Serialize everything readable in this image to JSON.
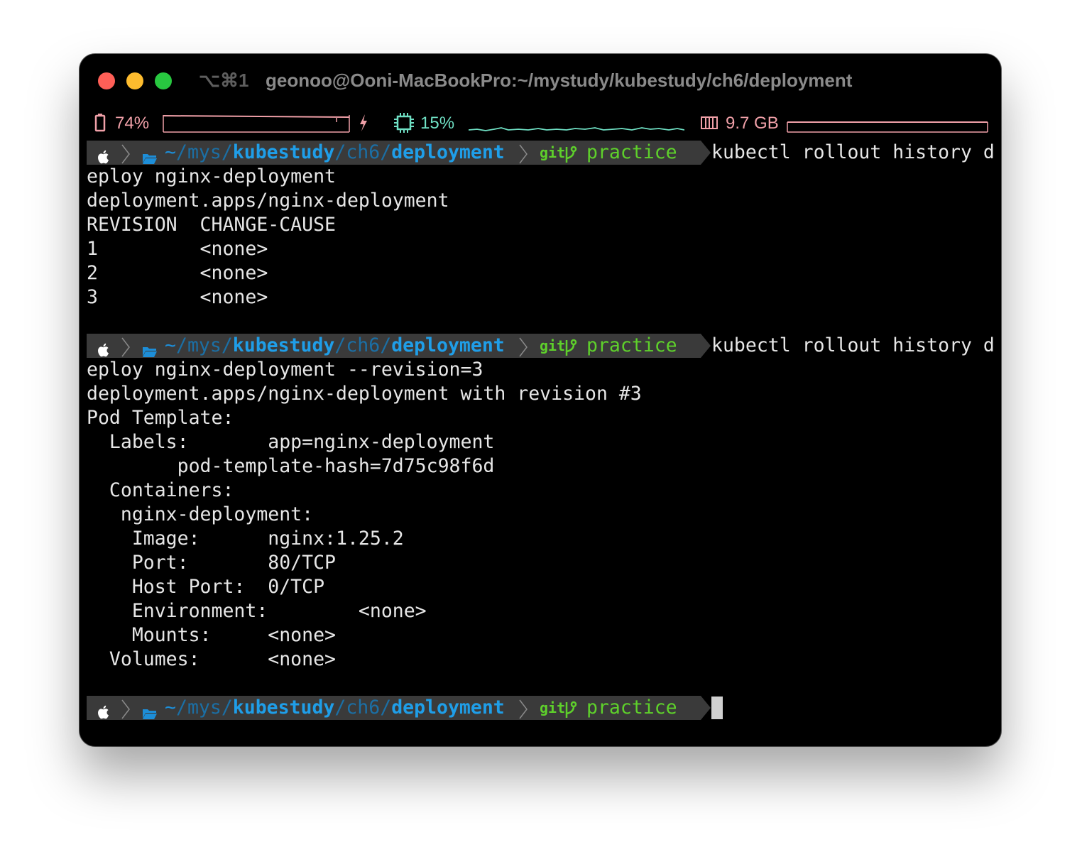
{
  "window": {
    "shortcut": "⌥⌘1",
    "title": "geonoo@Ooni-MacBookPro:~/mystudy/kubestudy/ch6/deployment"
  },
  "status": {
    "battery": "74%",
    "cpu": "15%",
    "memory": "9.7 GB"
  },
  "prompt": {
    "apple_icon": "apple-icon",
    "folder_icon": "folder-icon",
    "path_home": "~",
    "path_mys": "mys",
    "path_kubestudy": "kubestudy",
    "path_ch6": "ch6",
    "path_deployment": "deployment",
    "git_label": "git",
    "branch": "practice"
  },
  "block1": {
    "cmd_part1": "kubectl rollout history d",
    "cmd_part2": "eploy nginx-deployment",
    "output": [
      "deployment.apps/nginx-deployment",
      "REVISION  CHANGE-CAUSE",
      "1         <none>",
      "2         <none>",
      "3         <none>"
    ]
  },
  "block2": {
    "cmd_part1": "kubectl rollout history d",
    "cmd_part2": "eploy nginx-deployment --revision=3",
    "output": [
      "deployment.apps/nginx-deployment with revision #3",
      "Pod Template:",
      "  Labels:       app=nginx-deployment",
      "        pod-template-hash=7d75c98f6d",
      "  Containers:",
      "   nginx-deployment:",
      "    Image:      nginx:1.25.2",
      "    Port:       80/TCP",
      "    Host Port:  0/TCP",
      "    Environment:        <none>",
      "    Mounts:     <none>",
      "  Volumes:      <none>"
    ]
  },
  "colors": {
    "background": "#000000",
    "path_blue": "#1f9ee8",
    "git_green": "#5ed02b",
    "battery_pink": "#f0a0a8",
    "cpu_teal": "#6fe0c4"
  }
}
